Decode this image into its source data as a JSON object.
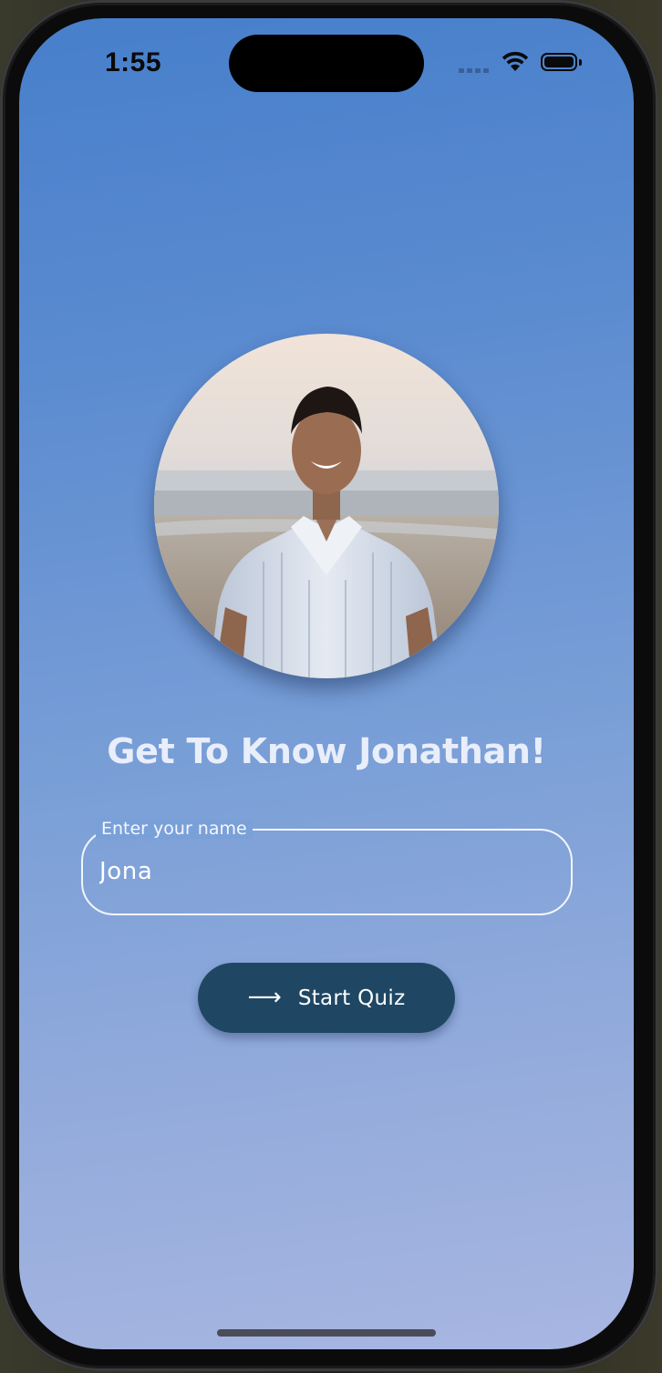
{
  "status_bar": {
    "time": "1:55",
    "wifi_icon": "wifi-icon",
    "battery_icon": "battery-icon"
  },
  "profile": {
    "photo_description": "profile-photo"
  },
  "headline": "Get To Know Jonathan!",
  "name_field": {
    "label": "Enter your name",
    "value": "Jona"
  },
  "start_button": {
    "icon": "arrow-right-icon",
    "label": "Start Quiz"
  },
  "colors": {
    "background_top": "#477fcb",
    "background_bottom": "#a8b6e2",
    "button": "#1f4763",
    "text_light": "#e9eefb"
  }
}
